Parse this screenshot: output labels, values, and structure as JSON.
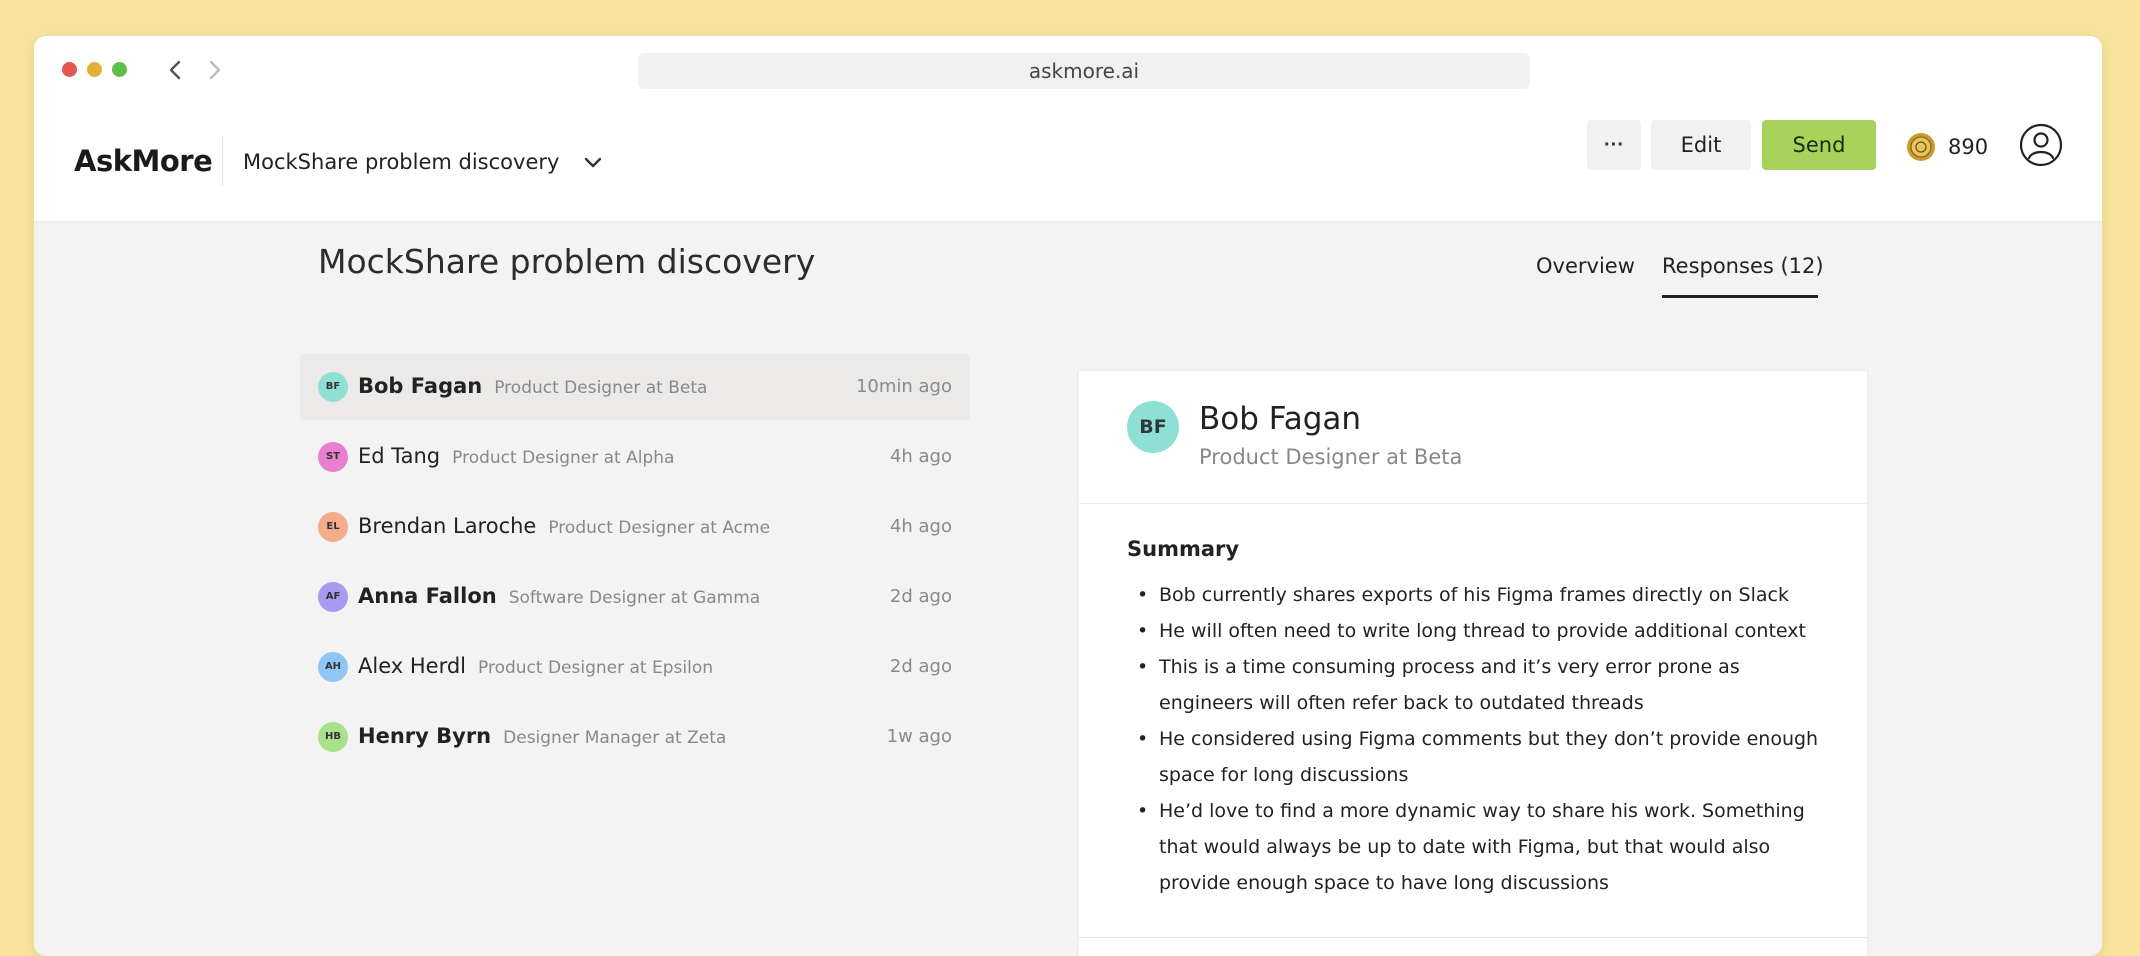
{
  "browser": {
    "url": "askmore.ai"
  },
  "header": {
    "logo": "AskMore",
    "project_name": "MockShare problem discovery",
    "more_label": "···",
    "edit_label": "Edit",
    "send_label": "Send",
    "coin_count": "890",
    "send_color": "#a7d35a"
  },
  "main": {
    "title": "MockShare problem discovery",
    "tabs": [
      {
        "label": "Overview",
        "active": false
      },
      {
        "label": "Responses (12)",
        "active": true
      }
    ]
  },
  "responses": [
    {
      "initials": "BF",
      "name": "Bob Fagan",
      "role": "Product Designer at Beta",
      "time": "10min ago",
      "avatar_color": "#8ee0d5",
      "selected": true,
      "bold": true
    },
    {
      "initials": "ST",
      "name": "Ed Tang",
      "role": "Product Designer at Alpha",
      "time": "4h ago",
      "avatar_color": "#e97fd0",
      "selected": false,
      "bold": false
    },
    {
      "initials": "EL",
      "name": "Brendan Laroche",
      "role": "Product Designer at Acme",
      "time": "4h ago",
      "avatar_color": "#f4ad88",
      "selected": false,
      "bold": false
    },
    {
      "initials": "AF",
      "name": "Anna Fallon",
      "role": "Software Designer at Gamma",
      "time": "2d ago",
      "avatar_color": "#a79bf0",
      "selected": false,
      "bold": true
    },
    {
      "initials": "AH",
      "name": "Alex Herdl",
      "role": "Product Designer at Epsilon",
      "time": "2d ago",
      "avatar_color": "#8fc6f5",
      "selected": false,
      "bold": false
    },
    {
      "initials": "HB",
      "name": "Henry Byrn",
      "role": "Designer Manager at Zeta",
      "time": "1w ago",
      "avatar_color": "#a8e08c",
      "selected": false,
      "bold": true
    }
  ],
  "detail": {
    "initials": "BF",
    "name": "Bob Fagan",
    "role": "Product Designer at Beta",
    "summary_heading": "Summary",
    "bullet_char": "•",
    "summary": [
      "Bob currently shares exports of his Figma frames directly on Slack",
      "He will often need to write long thread to provide additional context",
      "This is a time consuming process and it’s very error prone as engineers will often refer back to outdated threads",
      "He considered using Figma comments but they don’t provide enough space for long discussions",
      "He’d love to find a more dynamic way to share his work. Something that would always be up to date with Figma, but that would also provide enough space to have long discussions"
    ]
  }
}
